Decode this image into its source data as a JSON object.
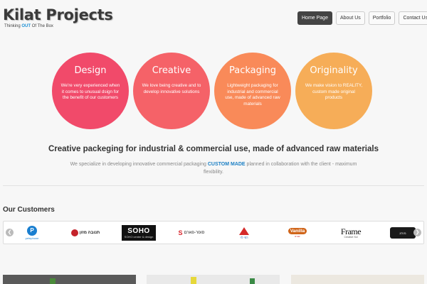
{
  "header": {
    "logo_title": "Kilat Projects",
    "tagline_pre": "Thinking ",
    "tagline_hl": "OUT",
    "tagline_post": " Of The Box"
  },
  "nav": {
    "items": [
      {
        "label": "Home Page",
        "active": true
      },
      {
        "label": "About Us",
        "active": false
      },
      {
        "label": "Portfolio",
        "active": false
      },
      {
        "label": "Contact Us",
        "active": false
      }
    ]
  },
  "features": [
    {
      "title": "Design",
      "text": "We're very experienced when it comes to unusual dsign for the benefit of our customers",
      "color": "#f14a6a"
    },
    {
      "title": "Creative",
      "text": "We love being creative and to develop innovative solutions",
      "color": "#f56268"
    },
    {
      "title": "Packaging",
      "text": "Lightweight packaging for industrial and commercial use, made of advanced raw materials",
      "color": "#f98a59"
    },
    {
      "title": "Originality",
      "text": "We make vision to REALITY, custom made original products",
      "color": "#f6ad58"
    }
  ],
  "intro": {
    "headline": "Creative packeging for industrial & commercial use, made of advanced raw materials",
    "sub_pre": "We specialize in developing innovative commercial packaging ",
    "sub_em": "CUSTOM MADE",
    "sub_post": " planned in collaboration with the client - maximum flexibility."
  },
  "customers": {
    "title": "Our Customers",
    "logos": [
      {
        "name": "pelephone",
        "text": "P",
        "sub": "pelephone"
      },
      {
        "name": "tnuva",
        "text": "תנובה מזון"
      },
      {
        "name": "soho",
        "text": "SOHO",
        "sub": "SOHO center & design"
      },
      {
        "name": "super-pharm",
        "mark": "S",
        "text": "סופר-פארם"
      },
      {
        "name": "rami-levy",
        "sub": "רמי לוי"
      },
      {
        "name": "vanilla",
        "text": "Vanilla",
        "sub": "יוגורט"
      },
      {
        "name": "frame",
        "text": "Frame",
        "sub": "Creative Sol"
      },
      {
        "name": "dark-brand",
        "text": "מותג"
      }
    ]
  },
  "colors": {
    "accent": "#1b8fd4",
    "nav_active_bg": "#444444"
  }
}
